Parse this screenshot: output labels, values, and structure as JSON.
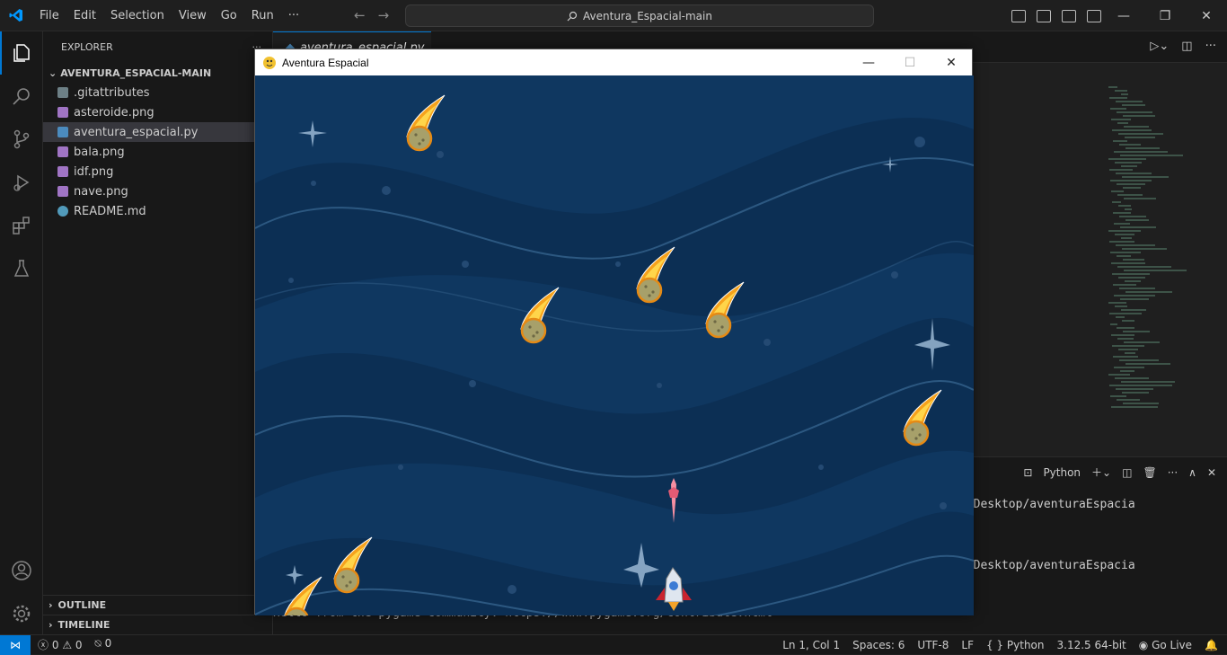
{
  "menu": [
    "File",
    "Edit",
    "Selection",
    "View",
    "Go",
    "Run",
    "···"
  ],
  "search": {
    "label": "Aventura_Espacial-main"
  },
  "explorer": {
    "title": "EXPLORER",
    "folder": "AVENTURA_ESPACIAL-MAIN",
    "files": [
      {
        "name": ".gitattributes",
        "icon": "git-icon",
        "color": "#6d8086"
      },
      {
        "name": "asteroide.png",
        "icon": "image-icon",
        "color": "#a074c4"
      },
      {
        "name": "aventura_espacial.py",
        "icon": "python-icon",
        "color": "#4b8bbe"
      },
      {
        "name": "bala.png",
        "icon": "image-icon",
        "color": "#a074c4"
      },
      {
        "name": "idf.png",
        "icon": "image-icon",
        "color": "#a074c4"
      },
      {
        "name": "nave.png",
        "icon": "image-icon",
        "color": "#a074c4"
      },
      {
        "name": "README.md",
        "icon": "info-icon",
        "color": "#519aba"
      }
    ],
    "outline": "OUTLINE",
    "timeline": "TIMELINE"
  },
  "tab": {
    "label": "aventura_espacial.py"
  },
  "terminal": {
    "profile": "Python",
    "lines": [
      "a/Desktop/aventuraEspacia",
      "a/Desktop/aventuraEspacia",
      "Hello from the pygame community. https://www.pygame.org/contribute.html"
    ]
  },
  "game": {
    "title": "Aventura Espacial"
  },
  "status": {
    "errors": "0",
    "warnings": "0",
    "ports": "0",
    "position": "Ln 1, Col 1",
    "spaces": "Spaces: 6",
    "encoding": "UTF-8",
    "eol": "LF",
    "language": "Python",
    "interpreter": "3.12.5 64-bit",
    "golive": "Go Live"
  },
  "colors": {
    "accent": "#0078d4",
    "game_bg": "#0c2f54"
  }
}
